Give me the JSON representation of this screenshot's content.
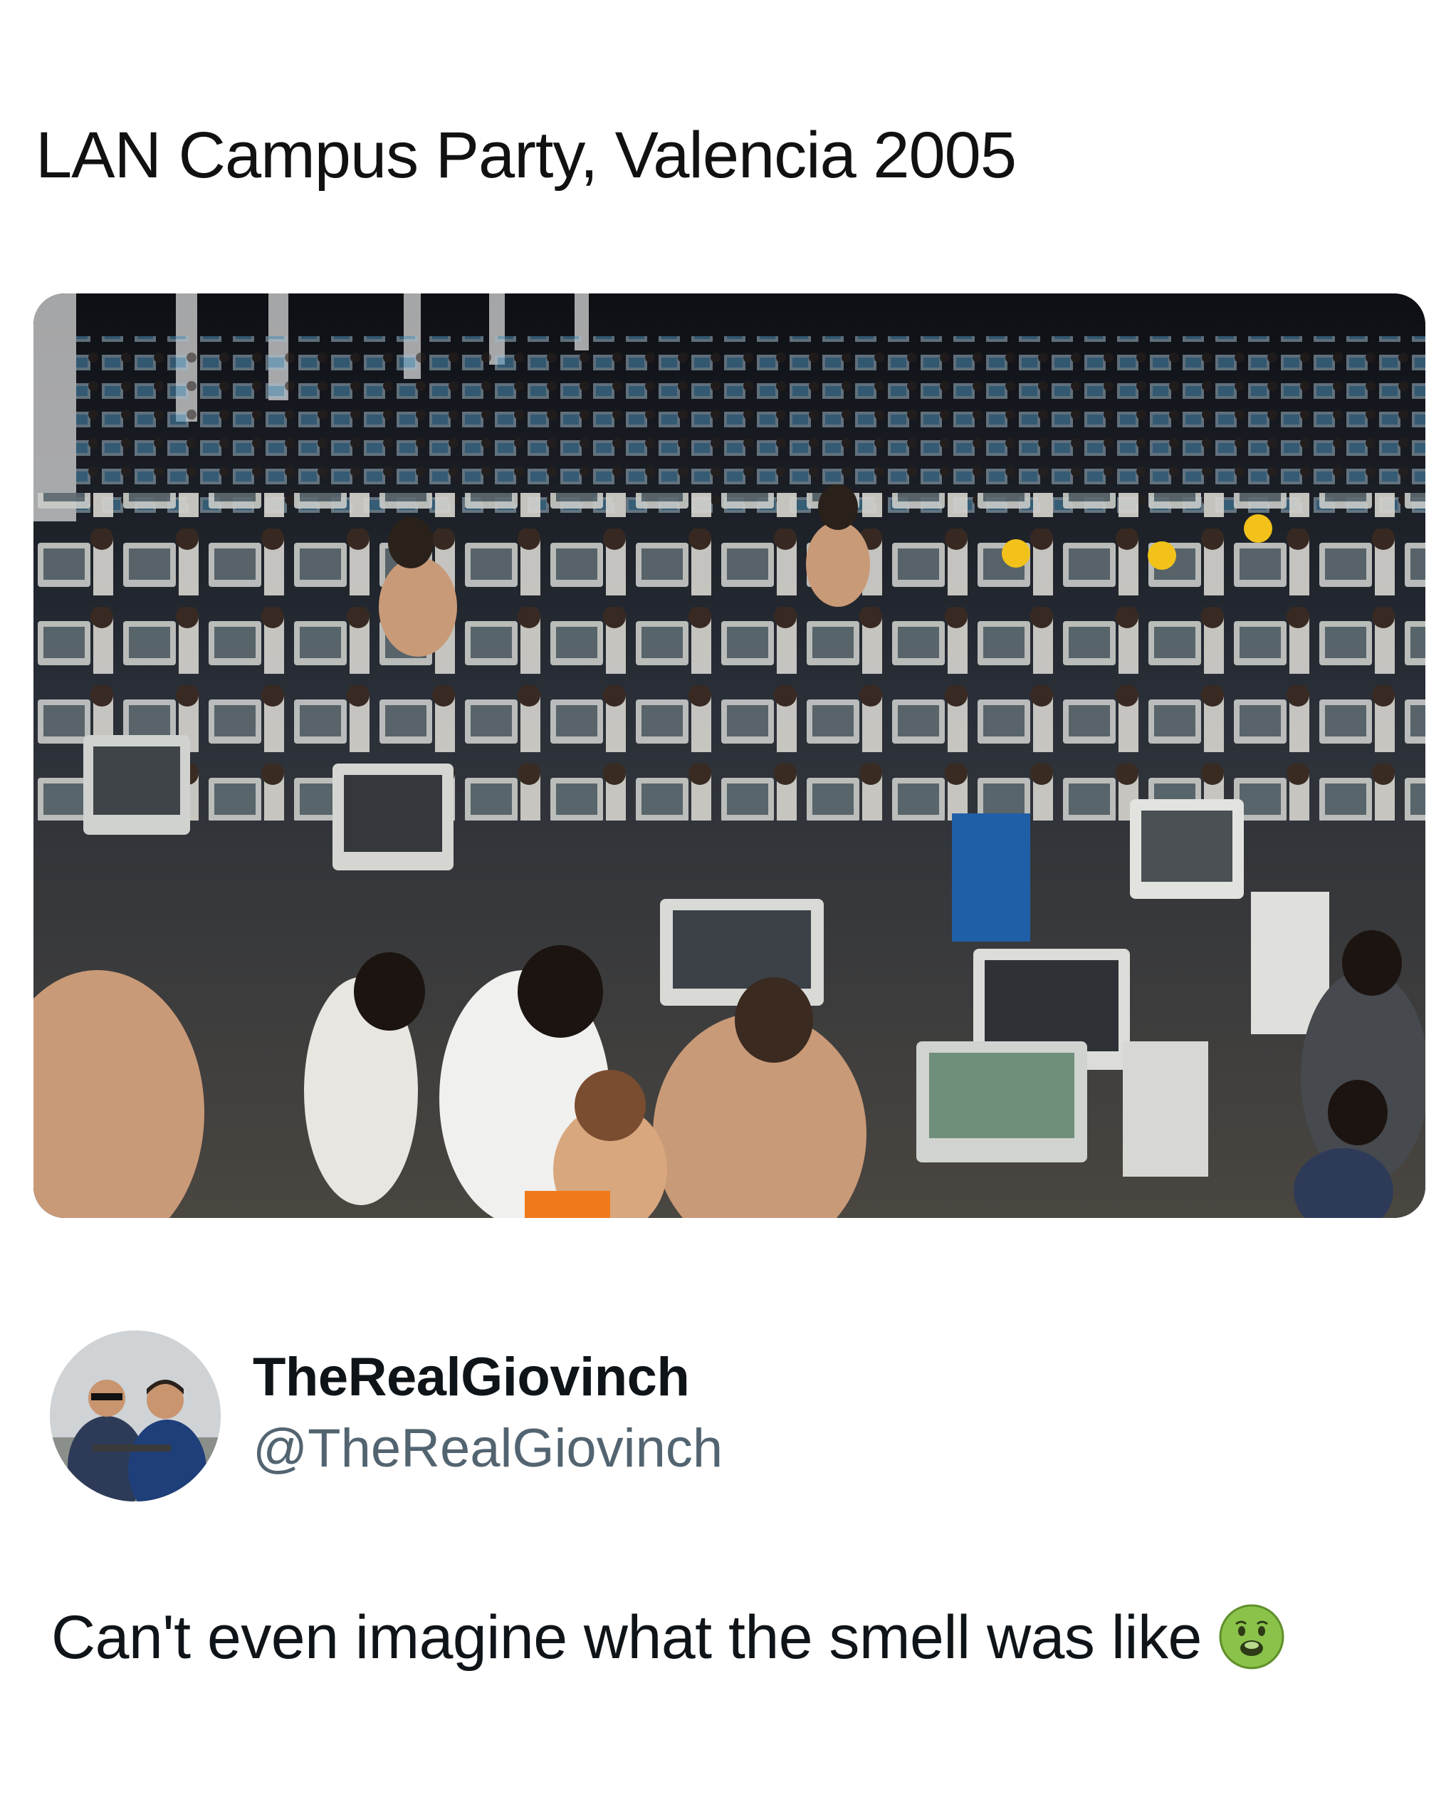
{
  "post": {
    "caption": "LAN Campus Party, Valencia 2005",
    "image": {
      "subject": "crowded-lan-party-hall",
      "icon": "photo"
    }
  },
  "tweet": {
    "author": {
      "display_name": "TheRealGiovinch",
      "handle": "@TheRealGiovinch",
      "avatar_icon": "avatar-photo"
    },
    "text": "Can't even imagine what the smell was like",
    "emoji": "nauseated-face-icon"
  },
  "colors": {
    "text_primary": "#0f1419",
    "text_secondary": "#536471",
    "emoji_green": "#8bc34a"
  }
}
